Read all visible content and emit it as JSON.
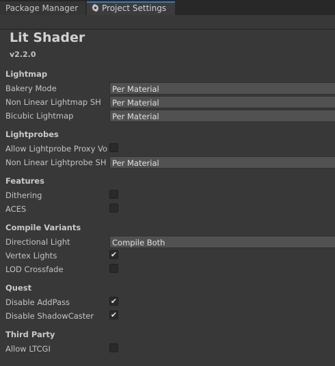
{
  "tabs": {
    "package_manager": "Package Manager",
    "project_settings": "Project Settings",
    "project_settings_icon": "gear-icon"
  },
  "header": {
    "title": "Lit Shader",
    "version": "v2.2.0"
  },
  "sections": {
    "lightmap": {
      "title": "Lightmap",
      "bakery_mode": {
        "label": "Bakery Mode",
        "value": "Per Material"
      },
      "non_linear_lightmap_sh": {
        "label": "Non Linear Lightmap SH",
        "value": "Per Material"
      },
      "bicubic_lightmap": {
        "label": "Bicubic Lightmap",
        "value": "Per Material"
      }
    },
    "lightprobes": {
      "title": "Lightprobes",
      "allow_lightprobe_proxy_vol": {
        "label": "Allow Lightprobe Proxy Vol",
        "checked": false
      },
      "non_linear_lightprobe_sh": {
        "label": "Non Linear Lightprobe SH",
        "value": "Per Material"
      }
    },
    "features": {
      "title": "Features",
      "dithering": {
        "label": "Dithering",
        "checked": false
      },
      "aces": {
        "label": "ACES",
        "checked": false
      }
    },
    "compile_variants": {
      "title": "Compile Variants",
      "directional_light": {
        "label": "Directional Light",
        "value": "Compile Both"
      },
      "vertex_lights": {
        "label": "Vertex Lights",
        "checked": true
      },
      "lod_crossfade": {
        "label": "LOD Crossfade",
        "checked": false
      }
    },
    "quest": {
      "title": "Quest",
      "disable_addpass": {
        "label": "Disable AddPass",
        "checked": true
      },
      "disable_shadowcaster": {
        "label": "Disable ShadowCaster",
        "checked": true
      }
    },
    "third_party": {
      "title": "Third Party",
      "allow_ltcgi": {
        "label": "Allow LTCGI",
        "checked": false
      }
    }
  },
  "colors": {
    "background": "#383838",
    "tabbar": "#282828",
    "active_tab_accent": "#3a79bb",
    "dropdown": "#515151",
    "checkbox": "#2a2a2a"
  }
}
